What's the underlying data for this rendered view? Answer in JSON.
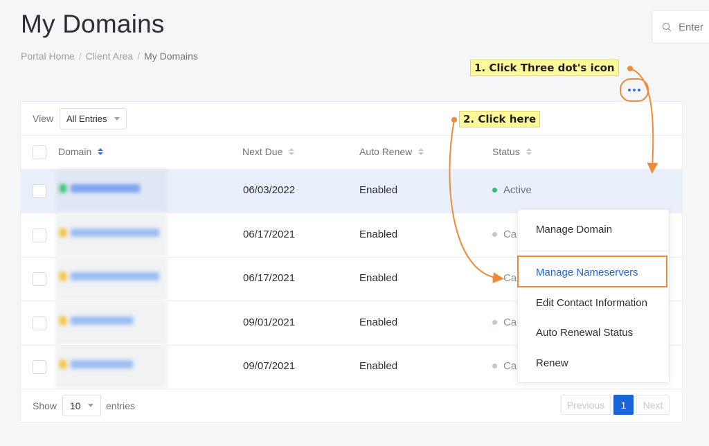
{
  "page": {
    "title": "My Domains",
    "breadcrumb": [
      "Portal Home",
      "Client Area",
      "My Domains"
    ]
  },
  "search": {
    "placeholder": "Enter"
  },
  "toolbar": {
    "view_label": "View",
    "view_value": "All Entries"
  },
  "table": {
    "headers": {
      "domain": "Domain",
      "next_due": "Next Due",
      "auto_renew": "Auto Renew",
      "status": "Status"
    },
    "rows": [
      {
        "next_due": "06/03/2022",
        "auto_renew": "Enabled",
        "status": "Active"
      },
      {
        "next_due": "06/17/2021",
        "auto_renew": "Enabled",
        "status": "Ca"
      },
      {
        "next_due": "06/17/2021",
        "auto_renew": "Enabled",
        "status": "Ca"
      },
      {
        "next_due": "09/01/2021",
        "auto_renew": "Enabled",
        "status": "Ca"
      },
      {
        "next_due": "09/07/2021",
        "auto_renew": "Enabled",
        "status": "Ca"
      }
    ]
  },
  "dropdown": {
    "items": [
      "Manage Domain",
      "Manage Nameservers",
      "Edit Contact Information",
      "Auto Renewal Status",
      "Renew"
    ]
  },
  "footer": {
    "show_label": "Show",
    "show_value": "10",
    "entries_label": "entries",
    "prev": "Previous",
    "page": "1",
    "next": "Next"
  },
  "annotations": {
    "step1": "1. Click Three dot's icon",
    "step2": "2. Click here"
  },
  "colors": {
    "accent": "#1a66d9",
    "annotation": "#f08a3b",
    "active_dot": "#2fbf71",
    "cancel_dot": "#c3c8cd",
    "callout_bg": "#fff99b"
  }
}
